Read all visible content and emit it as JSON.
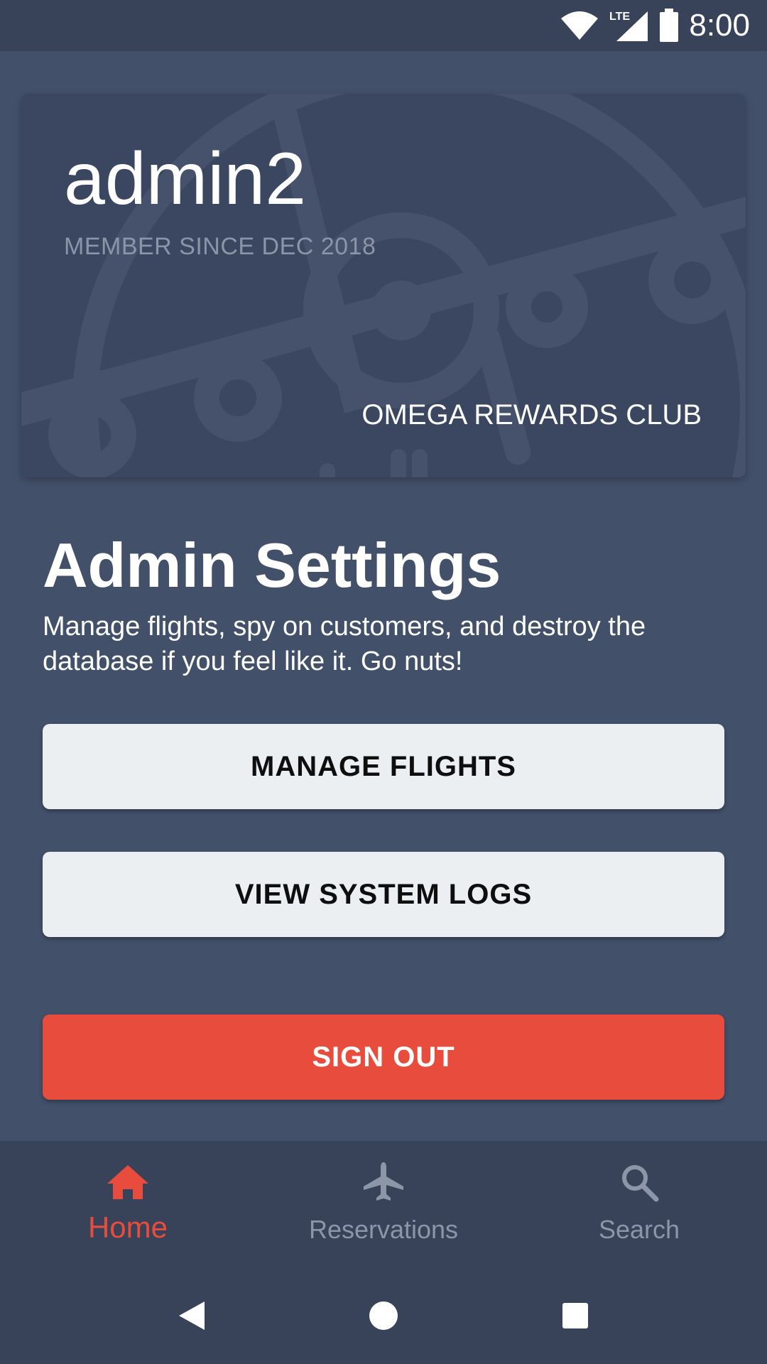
{
  "status_bar": {
    "network_label": "LTE",
    "time": "8:00"
  },
  "member_card": {
    "username": "admin2",
    "member_since": "MEMBER SINCE DEC 2018",
    "club_name": "OMEGA REWARDS CLUB"
  },
  "admin_section": {
    "title": "Admin Settings",
    "description": "Manage flights, spy on customers, and destroy the database if you feel like it. Go nuts!"
  },
  "buttons": {
    "manage_flights": "MANAGE FLIGHTS",
    "view_system_logs": "VIEW SYSTEM LOGS",
    "sign_out": "SIGN OUT"
  },
  "bottom_nav": {
    "items": [
      {
        "label": "Home",
        "icon": "home-icon",
        "active": true
      },
      {
        "label": "Reservations",
        "icon": "airplane-icon",
        "active": false
      },
      {
        "label": "Search",
        "icon": "search-icon",
        "active": false
      }
    ]
  },
  "colors": {
    "background": "#43506a",
    "bars": "#384258",
    "card": "#3b4660",
    "accent": "#e84c3d",
    "button_light": "#eceff1",
    "muted_text": "#8d96a8"
  }
}
